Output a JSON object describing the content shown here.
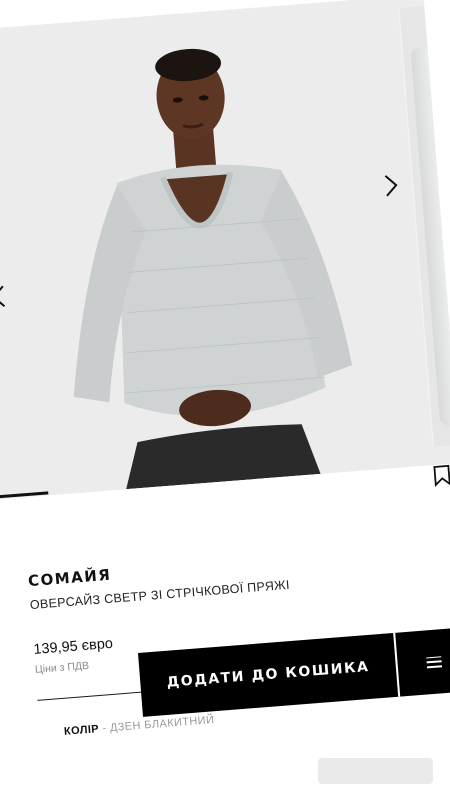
{
  "carousel": {
    "image_alt": "",
    "prev_icon": "chevron-left-icon",
    "next_icon": "chevron-right-icon",
    "progress": 0.14
  },
  "product": {
    "brand": "СОМАЙЯ",
    "name": "ОВЕРСАЙЗ СВЕТР ЗІ СТРІЧКОВОЇ ПРЯЖІ",
    "price": "139,95 євро",
    "price_note": "Ціни з ПДВ",
    "color_label": "КОЛІР",
    "color_value": "- ДЗЕН БЛАКИТНИЙ"
  },
  "actions": {
    "add_to_cart": "ДОДАТИ ДО КОШИКА",
    "menu_icon": "menu-icon"
  },
  "colors": {
    "background": "#ececec",
    "button": "#000000",
    "button_text": "#ffffff"
  }
}
